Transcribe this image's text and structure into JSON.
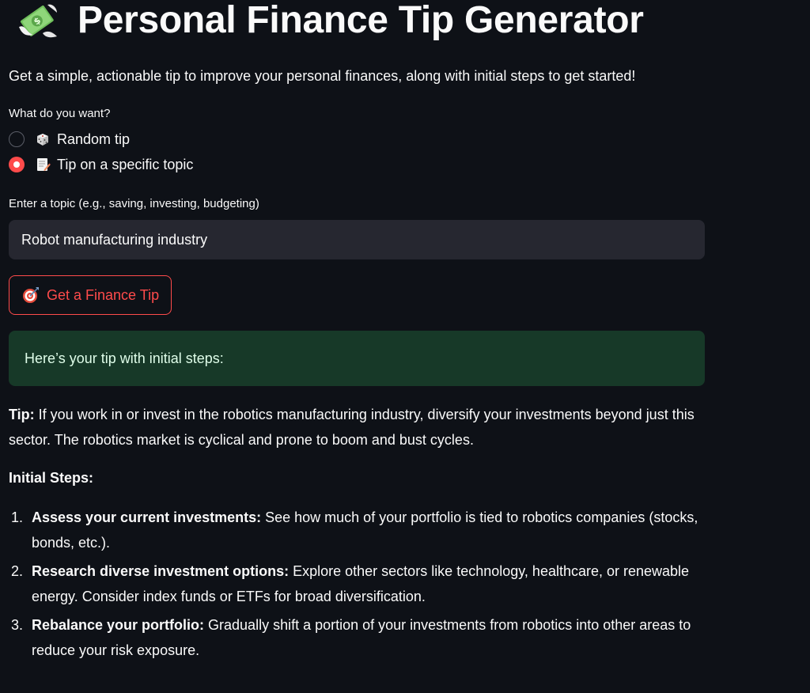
{
  "header": {
    "title": "Personal Finance Tip Generator",
    "title_icon": "money-with-wings-icon"
  },
  "subtitle": "Get a simple, actionable tip to improve your personal finances, along with initial steps to get started!",
  "tip_mode": {
    "label": "What do you want?",
    "options": [
      {
        "label": "Random tip",
        "icon": "dice-icon",
        "selected": false
      },
      {
        "label": "Tip on a specific topic",
        "icon": "memo-icon",
        "selected": true
      }
    ]
  },
  "topic": {
    "label": "Enter a topic (e.g., saving, investing, budgeting)",
    "value": "Robot manufacturing industry"
  },
  "button": {
    "label": "Get a Finance Tip",
    "icon": "target-icon"
  },
  "result": {
    "banner": "Here’s your tip with initial steps:",
    "tip_label": "Tip:",
    "tip_text": " If you work in or invest in the robotics manufacturing industry, diversify your investments beyond just this sector. The robotics market is cyclical and prone to boom and bust cycles.",
    "steps_heading": "Initial Steps:",
    "steps": [
      {
        "num": "1.",
        "title": "Assess your current investments:",
        "text": " See how much of your portfolio is tied to robotics companies (stocks, bonds, etc.)."
      },
      {
        "num": "2.",
        "title": "Research diverse investment options:",
        "text": " Explore other sectors like technology, healthcare, or renewable energy. Consider index funds or ETFs for broad diversification."
      },
      {
        "num": "3.",
        "title": "Rebalance your portfolio:",
        "text": " Gradually shift a portion of your investments from robotics into other areas to reduce your risk exposure."
      }
    ]
  },
  "colors": {
    "background": "#0e1117",
    "accent": "#ff4b4b",
    "input_bg": "#262730",
    "success_bg": "#173928"
  }
}
